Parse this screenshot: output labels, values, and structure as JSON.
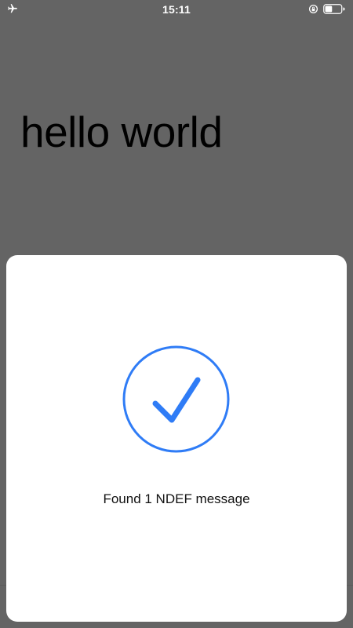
{
  "status_bar": {
    "time": "15:11",
    "left_icon": "airplane-icon",
    "right_icons": [
      "rotation-lock-icon",
      "battery-icon"
    ],
    "battery_level": 0.45
  },
  "main": {
    "text": "hello world"
  },
  "nfc_sheet": {
    "icon": "checkmark-circle-icon",
    "message": "Found 1 NDEF message",
    "accent_color": "#2f7cf6"
  }
}
